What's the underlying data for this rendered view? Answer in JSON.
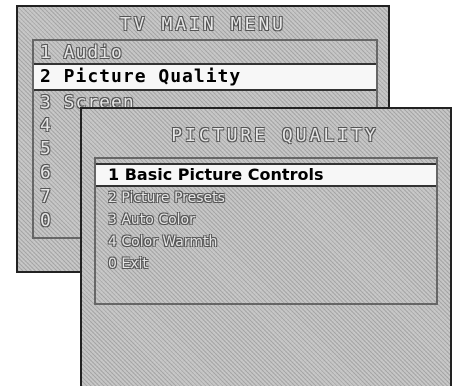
{
  "main_menu": {
    "title": "TV MAIN MENU",
    "items": [
      {
        "label": "1 Audio"
      },
      {
        "label": "2 Picture Quality"
      },
      {
        "label": "3 Screen"
      },
      {
        "label": "4"
      },
      {
        "label": "5"
      },
      {
        "label": "6"
      },
      {
        "label": "7"
      },
      {
        "label": "0"
      }
    ]
  },
  "picture_quality_menu": {
    "title": "PICTURE QUALITY",
    "items": [
      {
        "label": "1 Basic Picture Controls"
      },
      {
        "label": "2 Picture Presets"
      },
      {
        "label": "3 Auto Color"
      },
      {
        "label": "4 Color Warmth"
      },
      {
        "label": "0 Exit"
      }
    ]
  },
  "colors": {
    "panel_fill": "#c4c4c4",
    "highlight": "#f7f7f7",
    "outline_text": "#e6e6e6"
  }
}
